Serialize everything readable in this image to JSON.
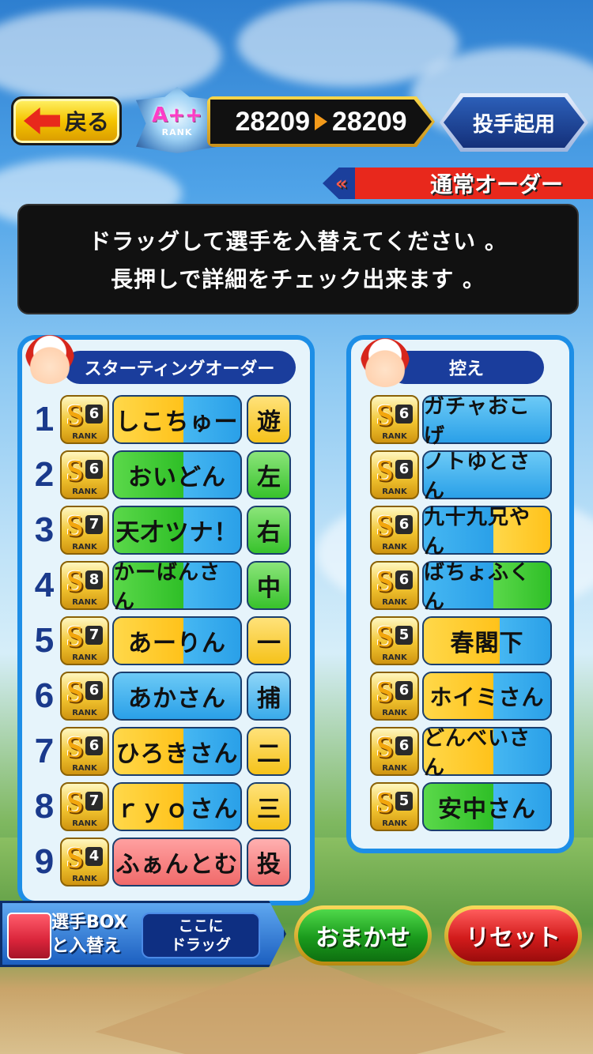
{
  "header": {
    "back_label": "戻る",
    "rank_text": "A++",
    "rank_sub": "RANK",
    "score_before": "28209",
    "score_after": "28209",
    "pitcher_button": "投手起用",
    "order_label": "通常オーダー"
  },
  "instruction": {
    "line1": "ドラッグして選手を入替えてください 。",
    "line2": "長押しで詳細をチェック出来ます 。"
  },
  "starting": {
    "title": "スターティングオーダー",
    "players": [
      {
        "order": "1",
        "rank": "S",
        "rank_num": "6",
        "rank_label": "RANK",
        "name": "しこちゅー",
        "pos": "遊"
      },
      {
        "order": "2",
        "rank": "S",
        "rank_num": "6",
        "rank_label": "RANK",
        "name": "おいどん",
        "pos": "左"
      },
      {
        "order": "3",
        "rank": "S",
        "rank_num": "7",
        "rank_label": "RANK",
        "name": "天才ツナ！",
        "pos": "右"
      },
      {
        "order": "4",
        "rank": "S",
        "rank_num": "8",
        "rank_label": "RANK",
        "name": "かーばんさん",
        "pos": "中"
      },
      {
        "order": "5",
        "rank": "S",
        "rank_num": "7",
        "rank_label": "RANK",
        "name": "あーりん",
        "pos": "一"
      },
      {
        "order": "6",
        "rank": "S",
        "rank_num": "6",
        "rank_label": "RANK",
        "name": "あかさん",
        "pos": "捕"
      },
      {
        "order": "7",
        "rank": "S",
        "rank_num": "6",
        "rank_label": "RANK",
        "name": "ひろきさん",
        "pos": "二"
      },
      {
        "order": "8",
        "rank": "S",
        "rank_num": "7",
        "rank_label": "RANK",
        "name": "ｒｙｏさん",
        "pos": "三"
      },
      {
        "order": "9",
        "rank": "S",
        "rank_num": "4",
        "rank_label": "RANK",
        "name": "ふぁんとむ",
        "pos": "投"
      }
    ]
  },
  "bench": {
    "title": "控え",
    "players": [
      {
        "rank": "S",
        "rank_num": "6",
        "rank_label": "RANK",
        "name": "ガチャおこげ"
      },
      {
        "rank": "S",
        "rank_num": "6",
        "rank_label": "RANK",
        "name": "ノトゆとさん"
      },
      {
        "rank": "S",
        "rank_num": "6",
        "rank_label": "RANK",
        "name": "九十九兄やん"
      },
      {
        "rank": "S",
        "rank_num": "6",
        "rank_label": "RANK",
        "name": "ばちょふくん"
      },
      {
        "rank": "S",
        "rank_num": "5",
        "rank_label": "RANK",
        "name": "春閣下"
      },
      {
        "rank": "S",
        "rank_num": "6",
        "rank_label": "RANK",
        "name": "ホイミさん"
      },
      {
        "rank": "S",
        "rank_num": "6",
        "rank_label": "RANK",
        "name": "どんべいさん"
      },
      {
        "rank": "S",
        "rank_num": "5",
        "rank_label": "RANK",
        "name": "安中さん"
      }
    ]
  },
  "footer": {
    "box_line1": "選手BOX",
    "box_line2": "と入替え",
    "drag_line1": "ここに",
    "drag_line2": "ドラッグ",
    "omakase_label": "おまかせ",
    "reset_label": "リセット"
  },
  "colors": {
    "panel_blue": "#1d8ee6",
    "header_navy": "#1a3d9c",
    "ribbon_red": "#e8281c",
    "rank_gold": "#f2c530"
  }
}
